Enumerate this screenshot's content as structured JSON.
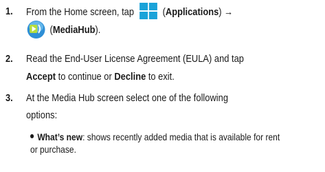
{
  "steps": [
    {
      "number": "1.",
      "line1_a": "From the Home screen, tap",
      "line1_b": "(",
      "line1_c": "Applications",
      "line1_d": ") →",
      "line2_a": "(",
      "line2_b": "MediaHub",
      "line2_c": ")."
    },
    {
      "number": "2.",
      "line1": "Read the End-User License Agreement (EULA) and tap",
      "line2_a": "Accept",
      "line2_b": " to continue or ",
      "line2_c": "Decline",
      "line2_d": " to exit."
    },
    {
      "number": "3.",
      "line1": "At the Media Hub screen select one of the following",
      "line2": "options:"
    }
  ],
  "bullets": [
    {
      "term": "What’s new",
      "text1": ": shows recently added media that is available for rent",
      "text2": "or purchase."
    }
  ],
  "icons": {
    "applications_color": "#1aa3d9",
    "mediahub_color": "#2e8fd6"
  }
}
